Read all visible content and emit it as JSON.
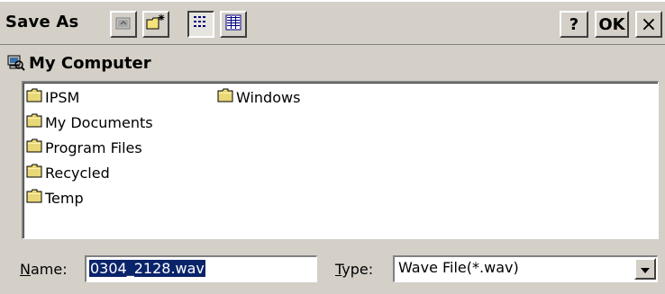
{
  "title": "Save As",
  "toolbar": {
    "buttons": [
      {
        "icon": "up-folder-icon"
      },
      {
        "icon": "new-folder-icon"
      },
      {
        "icon": "list-view-icon",
        "pressed": true
      },
      {
        "icon": "details-view-icon"
      }
    ],
    "help_label": "?",
    "ok_label": "OK",
    "close_label": "×"
  },
  "location": {
    "icon": "my-computer-icon",
    "text": "My Computer"
  },
  "files": [
    {
      "name": "IPSM"
    },
    {
      "name": "My Documents"
    },
    {
      "name": "Program Files"
    },
    {
      "name": "Recycled"
    },
    {
      "name": "Temp"
    },
    {
      "name": "Windows"
    }
  ],
  "fields": {
    "name_label_mnemonic": "N",
    "name_label_rest": "ame:",
    "name_value": "0304_2128.wav",
    "type_label_mnemonic": "T",
    "type_label_rest": "ype:",
    "type_value": "Wave File(*.wav)"
  },
  "colors": {
    "face": "#d4d0c8",
    "selection": "#0a246a",
    "folder": "#e8d878"
  }
}
